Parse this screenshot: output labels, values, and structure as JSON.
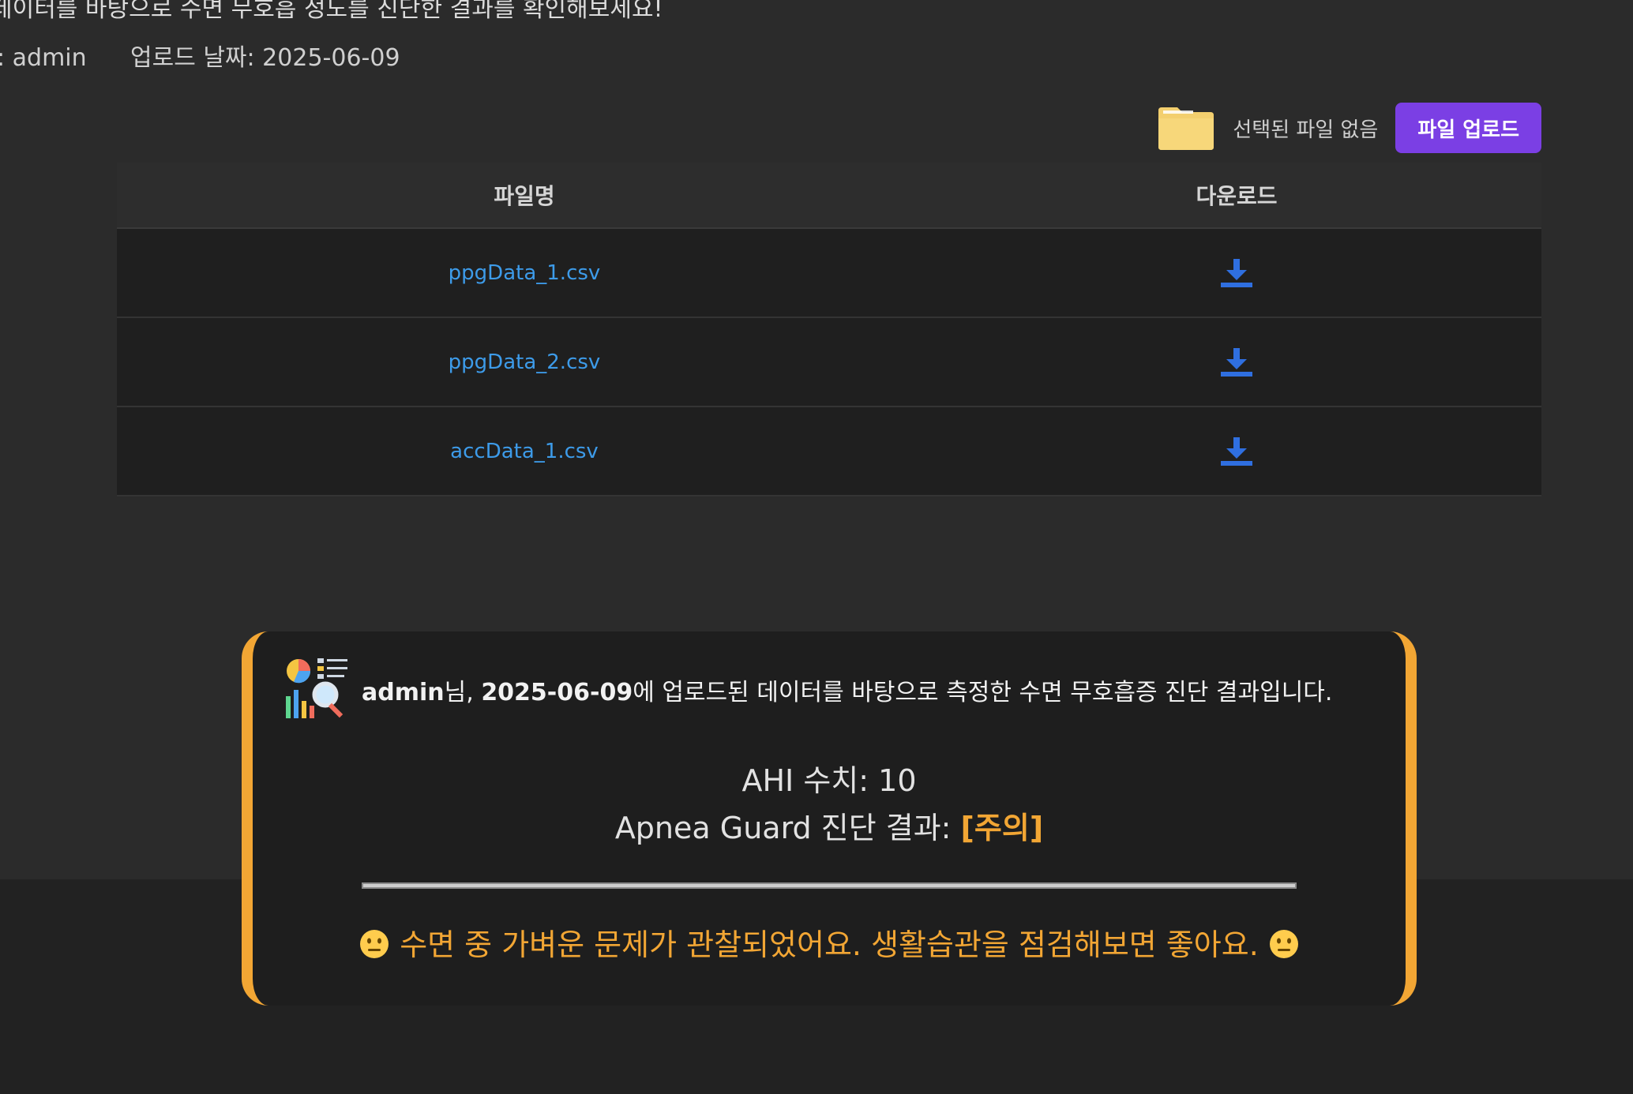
{
  "page": {
    "intro_text": "데이터를 바탕으로 수면 무호흡 정도를 진단한 결과를 확인해보세요!",
    "user_label": ": admin",
    "upload_date_label": "업로드 날짜: 2025-06-09"
  },
  "upload": {
    "folder_icon": "folder-icon",
    "file_status": "선택된 파일 없음",
    "button_label": "파일 업로드",
    "accent_color": "#7b3fe4"
  },
  "table": {
    "headers": [
      "파일명",
      "다운로드"
    ],
    "rows": [
      {
        "filename": "ppgData_1.csv",
        "download_icon": "download-icon"
      },
      {
        "filename": "ppgData_2.csv",
        "download_icon": "download-icon"
      },
      {
        "filename": "accData_1.csv",
        "download_icon": "download-icon"
      }
    ],
    "link_color": "#3d9be9"
  },
  "result": {
    "icon": "report-analytics-icon",
    "user": "admin",
    "user_suffix": "님, ",
    "date": "2025-06-09",
    "intro_rest": "에 업로드된 데이터를 바탕으로 측정한 수면 무호흡증 진단 결과입니다.",
    "ahi_label": "AHI 수치: 10",
    "verdict_label": "Apnea Guard 진단 결과: ",
    "verdict_tag": "[주의]",
    "advice": "수면 중 가벼운 문제가 관찰되었어요. 생활습관을 점검해보면 좋아요.",
    "accent_color": "#f2a634",
    "advice_emoji": "neutral-face-emoji"
  }
}
